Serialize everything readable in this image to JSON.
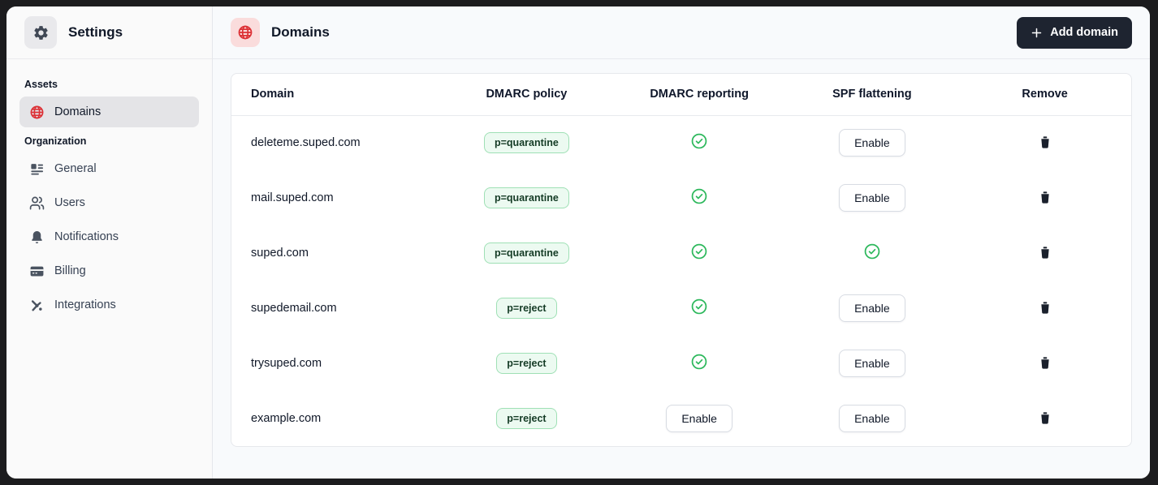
{
  "sidebar": {
    "title": "Settings",
    "sections": [
      {
        "label": "Assets",
        "items": [
          {
            "label": "Domains",
            "icon": "globe-icon",
            "active": true
          }
        ]
      },
      {
        "label": "Organization",
        "items": [
          {
            "label": "General",
            "icon": "general-icon"
          },
          {
            "label": "Users",
            "icon": "users-icon"
          },
          {
            "label": "Notifications",
            "icon": "bell-icon"
          },
          {
            "label": "Billing",
            "icon": "credit-card-icon"
          },
          {
            "label": "Integrations",
            "icon": "integrations-icon"
          }
        ]
      }
    ]
  },
  "header": {
    "title": "Domains",
    "add_button_label": "Add domain"
  },
  "table": {
    "columns": [
      "Domain",
      "DMARC policy",
      "DMARC reporting",
      "SPF flattening",
      "Remove"
    ],
    "enable_label": "Enable",
    "rows": [
      {
        "domain": "deleteme.suped.com",
        "dmarc_policy": "p=quarantine",
        "dmarc_reporting": "enabled",
        "spf_flattening": "enable"
      },
      {
        "domain": "mail.suped.com",
        "dmarc_policy": "p=quarantine",
        "dmarc_reporting": "enabled",
        "spf_flattening": "enable"
      },
      {
        "domain": "suped.com",
        "dmarc_policy": "p=quarantine",
        "dmarc_reporting": "enabled",
        "spf_flattening": "enabled"
      },
      {
        "domain": "supedemail.com",
        "dmarc_policy": "p=reject",
        "dmarc_reporting": "enabled",
        "spf_flattening": "enable"
      },
      {
        "domain": "trysuped.com",
        "dmarc_policy": "p=reject",
        "dmarc_reporting": "enabled",
        "spf_flattening": "enable"
      },
      {
        "domain": "example.com",
        "dmarc_policy": "p=reject",
        "dmarc_reporting": "enable",
        "spf_flattening": "enable"
      }
    ]
  },
  "colors": {
    "accent_red": "#dc3035",
    "success_green": "#2db85c",
    "badge_bg": "#ecfaf1",
    "badge_border": "#9fe0b5",
    "dark_button": "#1e2430"
  }
}
